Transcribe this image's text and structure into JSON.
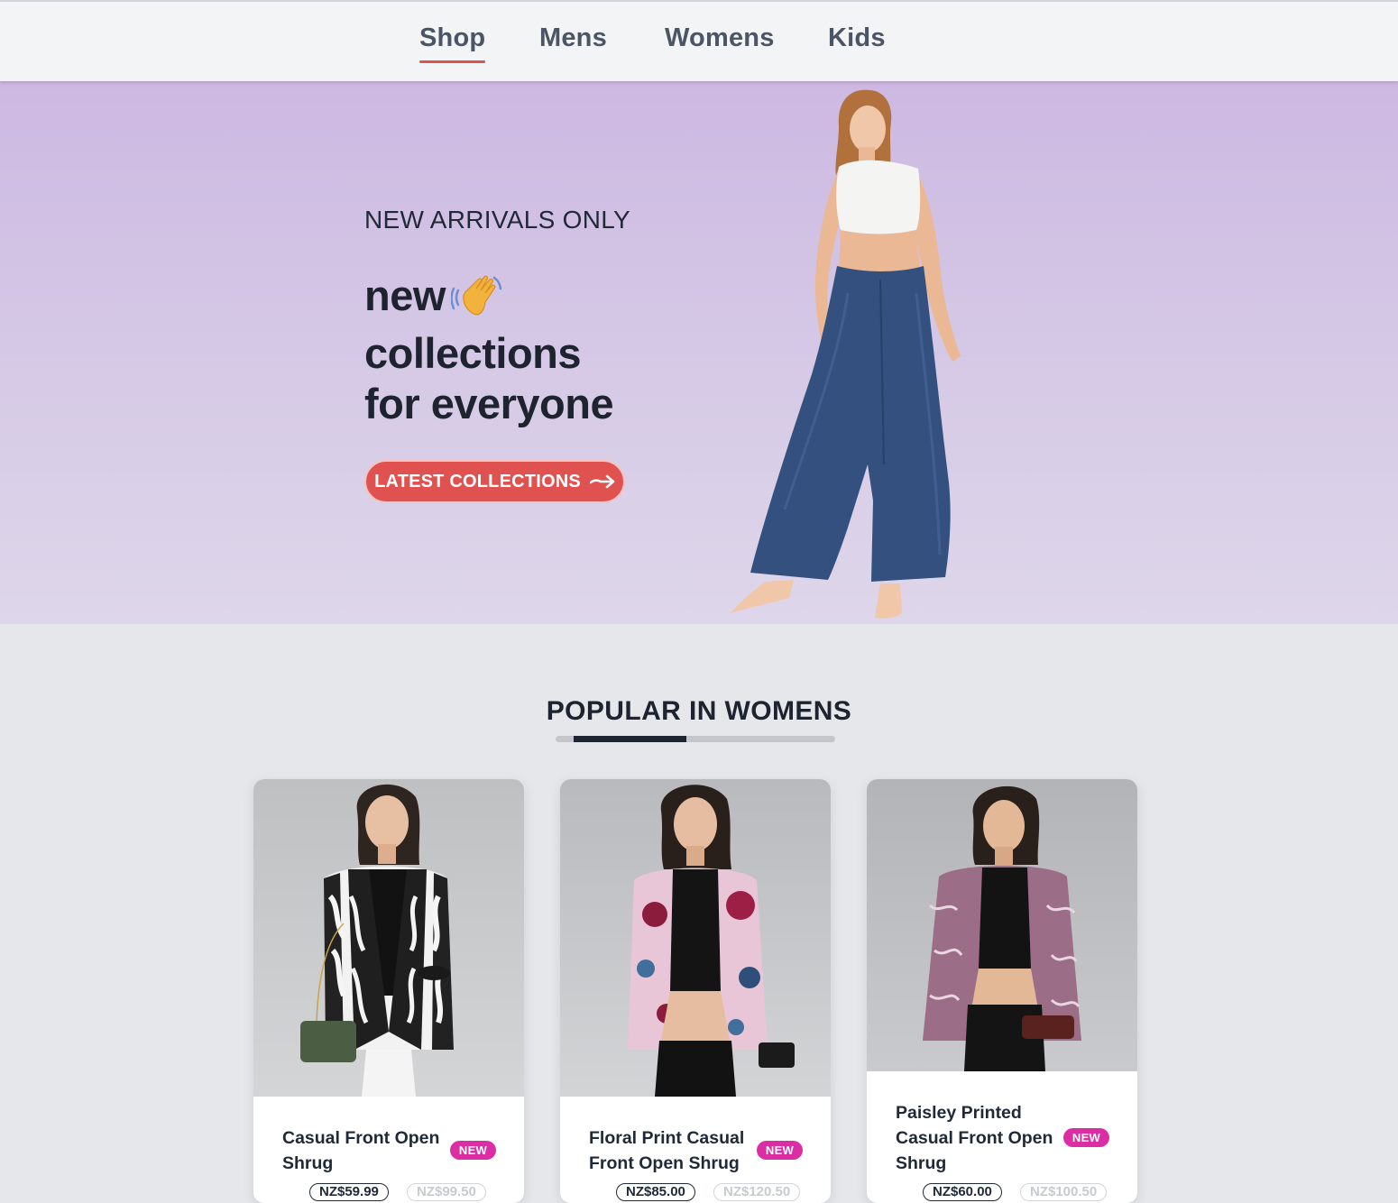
{
  "nav": {
    "items": [
      {
        "label": "Shop",
        "active": true
      },
      {
        "label": "Mens",
        "active": false
      },
      {
        "label": "Womens",
        "active": false
      },
      {
        "label": "Kids",
        "active": false
      }
    ]
  },
  "hero": {
    "kicker": "NEW ARRIVALS ONLY",
    "line1": "new",
    "line2": "collections",
    "line3": "for everyone",
    "cta_label": "LATEST COLLECTIONS",
    "icon": "waving-hand-icon"
  },
  "section": {
    "title": "POPULAR IN WOMENS"
  },
  "products": [
    {
      "name": "Casual Front Open Shrug",
      "badge": "NEW",
      "price": "NZ$59.99",
      "old_price": "NZ$99.50"
    },
    {
      "name": "Floral Print Casual Front Open Shrug",
      "badge": "NEW",
      "price": "NZ$85.00",
      "old_price": "NZ$120.50"
    },
    {
      "name": "Paisley Printed Casual Front Open Shrug",
      "badge": "NEW",
      "price": "NZ$60.00",
      "old_price": "NZ$100.50"
    }
  ],
  "colors": {
    "accent": "#e0524f",
    "badge": "#db2ea4",
    "hero_bg": "#d6cae6",
    "text_dark": "#1e2330"
  }
}
